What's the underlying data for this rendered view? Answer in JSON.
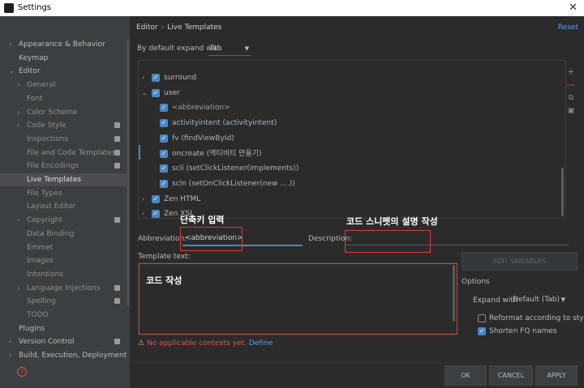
{
  "window": {
    "title": "Settings"
  },
  "sidebar": {
    "items": [
      {
        "label": "Appearance & Behavior",
        "level": 0,
        "arrow": "›",
        "selected": false,
        "badge": false
      },
      {
        "label": "Keymap",
        "level": 0,
        "arrow": "",
        "selected": false,
        "badge": false
      },
      {
        "label": "Editor",
        "level": 0,
        "arrow": "⌄",
        "selected": false,
        "badge": false
      },
      {
        "label": "General",
        "level": 1,
        "arrow": "›",
        "selected": false,
        "badge": false
      },
      {
        "label": "Font",
        "level": 1,
        "arrow": "",
        "selected": false,
        "badge": false
      },
      {
        "label": "Color Scheme",
        "level": 1,
        "arrow": "›",
        "selected": false,
        "badge": false
      },
      {
        "label": "Code Style",
        "level": 1,
        "arrow": "›",
        "selected": false,
        "badge": true
      },
      {
        "label": "Inspections",
        "level": 1,
        "arrow": "",
        "selected": false,
        "badge": true
      },
      {
        "label": "File and Code Templates",
        "level": 1,
        "arrow": "",
        "selected": false,
        "badge": true
      },
      {
        "label": "File Encodings",
        "level": 1,
        "arrow": "",
        "selected": false,
        "badge": true
      },
      {
        "label": "Live Templates",
        "level": 1,
        "arrow": "",
        "selected": true,
        "badge": false
      },
      {
        "label": "File Types",
        "level": 1,
        "arrow": "",
        "selected": false,
        "badge": false
      },
      {
        "label": "Layout Editor",
        "level": 1,
        "arrow": "",
        "selected": false,
        "badge": false
      },
      {
        "label": "Copyright",
        "level": 1,
        "arrow": "›",
        "selected": false,
        "badge": true
      },
      {
        "label": "Data Binding",
        "level": 1,
        "arrow": "",
        "selected": false,
        "badge": false
      },
      {
        "label": "Emmet",
        "level": 1,
        "arrow": "",
        "selected": false,
        "badge": false
      },
      {
        "label": "Images",
        "level": 1,
        "arrow": "",
        "selected": false,
        "badge": false
      },
      {
        "label": "Intentions",
        "level": 1,
        "arrow": "",
        "selected": false,
        "badge": false
      },
      {
        "label": "Language Injections",
        "level": 1,
        "arrow": "›",
        "selected": false,
        "badge": true
      },
      {
        "label": "Spelling",
        "level": 1,
        "arrow": "",
        "selected": false,
        "badge": true
      },
      {
        "label": "TODO",
        "level": 1,
        "arrow": "",
        "selected": false,
        "badge": false
      },
      {
        "label": "Plugins",
        "level": 0,
        "arrow": "",
        "selected": false,
        "badge": false
      },
      {
        "label": "Version Control",
        "level": 0,
        "arrow": "›",
        "selected": false,
        "badge": true
      },
      {
        "label": "Build, Execution, Deployment",
        "level": 0,
        "arrow": "›",
        "selected": false,
        "badge": false
      }
    ]
  },
  "header": {
    "breadcrumb_parent": "Editor",
    "breadcrumb_separator": "›",
    "breadcrumb_current": "Live Templates",
    "reset_label": "Reset"
  },
  "expand": {
    "label": "By default expand with",
    "value": "Tab"
  },
  "tree": {
    "rows": [
      {
        "kind": "grp",
        "label": "surround",
        "arrow": "›",
        "checked": true
      },
      {
        "kind": "grp",
        "label": "user",
        "arrow": "⌄",
        "checked": true
      },
      {
        "kind": "tmpl",
        "label": "<abbreviation>",
        "checked": true,
        "selected": true
      },
      {
        "kind": "tmpl",
        "label": "activityintent (activityintent)",
        "checked": true
      },
      {
        "kind": "tmpl",
        "label": "fv (findViewById)",
        "checked": true
      },
      {
        "kind": "tmpl",
        "label": "oncreate (액티비티 만들기)",
        "checked": true
      },
      {
        "kind": "tmpl",
        "label": "scli (setClickListener(implements))",
        "checked": true
      },
      {
        "kind": "tmpl",
        "label": "scln (setOnClickListener(new ....))",
        "checked": true
      },
      {
        "kind": "grp",
        "label": "Zen HTML",
        "arrow": "›",
        "checked": true
      },
      {
        "kind": "grp",
        "label": "Zen XSL",
        "arrow": "›",
        "checked": true
      }
    ]
  },
  "form": {
    "abbreviation_label": "Abbreviation:",
    "abbreviation_value": "<abbreviation>",
    "description_label": "Description:",
    "description_value": "",
    "template_text_label": "Template text:",
    "template_text_value": ""
  },
  "annotations": {
    "shortcut_input": "단축키 입력",
    "snippet_description": "코드 스니펫의 설명 작성",
    "code_writing": "코드 작성"
  },
  "warning": {
    "icon": "⚠",
    "text": "No applicable contexts yet.",
    "link": "Define"
  },
  "options": {
    "edit_variables_label": "EDIT VARIABLES",
    "title": "Options",
    "expand_with_label": "Expand with",
    "expand_with_value": "Default (Tab)",
    "reformat_label": "Reformat according to style",
    "reformat_checked": false,
    "shorten_label": "Shorten FQ names",
    "shorten_checked": true
  },
  "buttons": {
    "ok": "OK",
    "cancel": "CANCEL",
    "apply": "APPLY"
  },
  "colors": {
    "accent": "#4a88c7",
    "link": "#589df6",
    "annotation_box": "#e03d3d",
    "background": "#2b2b2b",
    "sidebar": "#3c3f41"
  }
}
